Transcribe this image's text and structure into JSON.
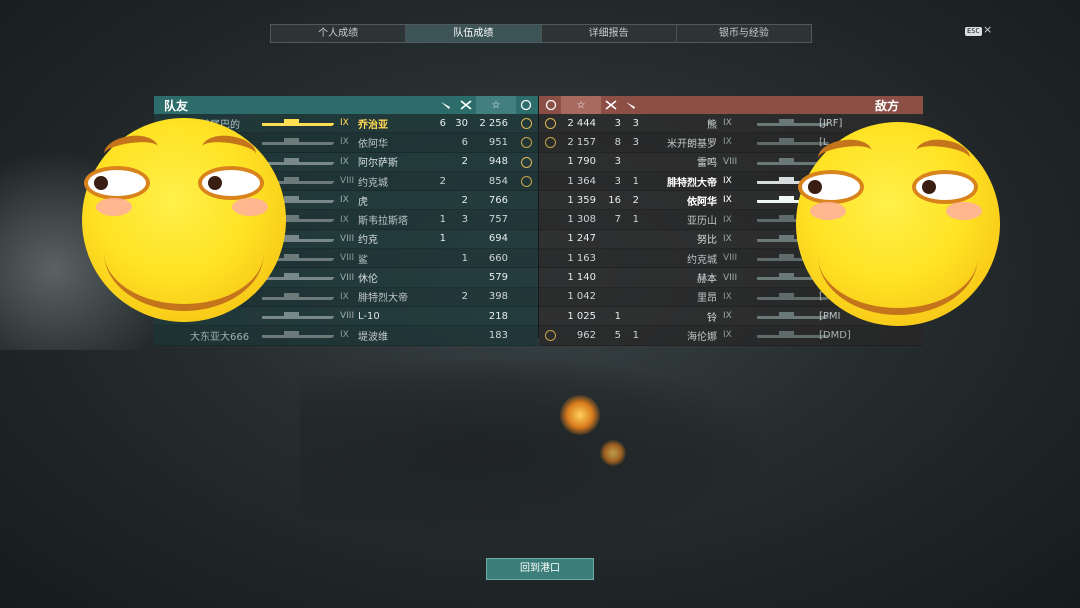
{
  "tabs": [
    "个人成绩",
    "队伍成绩",
    "详细报告",
    "银币与经验"
  ],
  "active_tab": 1,
  "esc_label": "ESC",
  "close_glyph": "×",
  "left": {
    "title": "队友",
    "header_icons": [
      "torpedo-icon",
      "plane-icon",
      "star-icon",
      "medal-icon"
    ],
    "rows": [
      {
        "player": "夹着尾巴的",
        "tier": "IX",
        "ship": "乔治亚",
        "c1": "6",
        "c2": "30",
        "score": "2 256",
        "medal": true,
        "highlight": true
      },
      {
        "player": "",
        "tier": "IX",
        "ship": "依阿华",
        "c1": "",
        "c2": "6",
        "score": "951",
        "medal": true
      },
      {
        "player": "",
        "tier": "IX",
        "ship": "阿尔萨斯",
        "c1": "",
        "c2": "2",
        "score": "948",
        "medal": true
      },
      {
        "player": "",
        "tier": "VIII",
        "ship": "约克城",
        "c1": "2",
        "c2": "",
        "score": "854",
        "medal": true
      },
      {
        "player": "",
        "tier": "IX",
        "ship": "虎",
        "c1": "",
        "c2": "2",
        "score": "766",
        "medal": false
      },
      {
        "player": "",
        "tier": "IX",
        "ship": "斯韦拉斯塔",
        "c1": "1",
        "c2": "3",
        "score": "757",
        "medal": false
      },
      {
        "player": "",
        "tier": "VIII",
        "ship": "约克",
        "c1": "1",
        "c2": "",
        "score": "694",
        "medal": false
      },
      {
        "player": "",
        "tier": "VIII",
        "ship": "鲨",
        "c1": "",
        "c2": "1",
        "score": "660",
        "medal": false
      },
      {
        "player": "",
        "tier": "VIII",
        "ship": "休伦",
        "c1": "",
        "c2": "",
        "score": "579",
        "medal": false
      },
      {
        "player": "",
        "tier": "IX",
        "ship": "腓特烈大帝",
        "c1": "",
        "c2": "2",
        "score": "398",
        "medal": false
      },
      {
        "player": "",
        "tier": "VIII",
        "ship": "L-10",
        "c1": "",
        "c2": "",
        "score": "218",
        "medal": false
      },
      {
        "player": "大东亚大666",
        "tier": "IX",
        "ship": "堤波维",
        "c1": "",
        "c2": "",
        "score": "183",
        "medal": false
      }
    ]
  },
  "right": {
    "title": "敌方",
    "header_icons": [
      "medal-icon",
      "star-icon",
      "plane-icon",
      "torpedo-icon"
    ],
    "rows": [
      {
        "medal": true,
        "score": "2 444",
        "c1": "3",
        "c2": "3",
        "ship": "熊",
        "tier": "IX",
        "tag": "[JRF]"
      },
      {
        "medal": true,
        "score": "2 157",
        "c1": "8",
        "c2": "3",
        "ship": "米开朗基罗",
        "tier": "IX",
        "tag": "[L"
      },
      {
        "medal": false,
        "score": "1 790",
        "c1": "3",
        "c2": "",
        "ship": "雷鸣",
        "tier": "VIII",
        "tag": ""
      },
      {
        "medal": false,
        "score": "1 364",
        "c1": "3",
        "c2": "1",
        "ship": "腓特烈大帝",
        "tier": "IX",
        "tag": "",
        "bright": true
      },
      {
        "medal": false,
        "score": "1 359",
        "c1": "16",
        "c2": "2",
        "ship": "依阿华",
        "tier": "IX",
        "tag": "",
        "bright": true
      },
      {
        "medal": false,
        "score": "1 308",
        "c1": "7",
        "c2": "1",
        "ship": "亚历山",
        "tier": "IX",
        "tag": ""
      },
      {
        "medal": false,
        "score": "1 247",
        "c1": "",
        "c2": "",
        "ship": "努比",
        "tier": "IX",
        "tag": ""
      },
      {
        "medal": false,
        "score": "1 163",
        "c1": "",
        "c2": "",
        "ship": "约克城",
        "tier": "VIII",
        "tag": ""
      },
      {
        "medal": false,
        "score": "1 140",
        "c1": "",
        "c2": "",
        "ship": "赫本",
        "tier": "VIII",
        "tag": ""
      },
      {
        "medal": false,
        "score": "1 042",
        "c1": "",
        "c2": "",
        "ship": "里昂",
        "tier": "IX",
        "tag": "["
      },
      {
        "medal": false,
        "score": "1 025",
        "c1": "1",
        "c2": "",
        "ship": "铃",
        "tier": "IX",
        "tag": "[PMI"
      },
      {
        "medal": true,
        "score": "962",
        "c1": "5",
        "c2": "1",
        "ship": "海伦娜",
        "tier": "IX",
        "tag": "[DMD]"
      }
    ]
  },
  "return_button": "回到港口"
}
